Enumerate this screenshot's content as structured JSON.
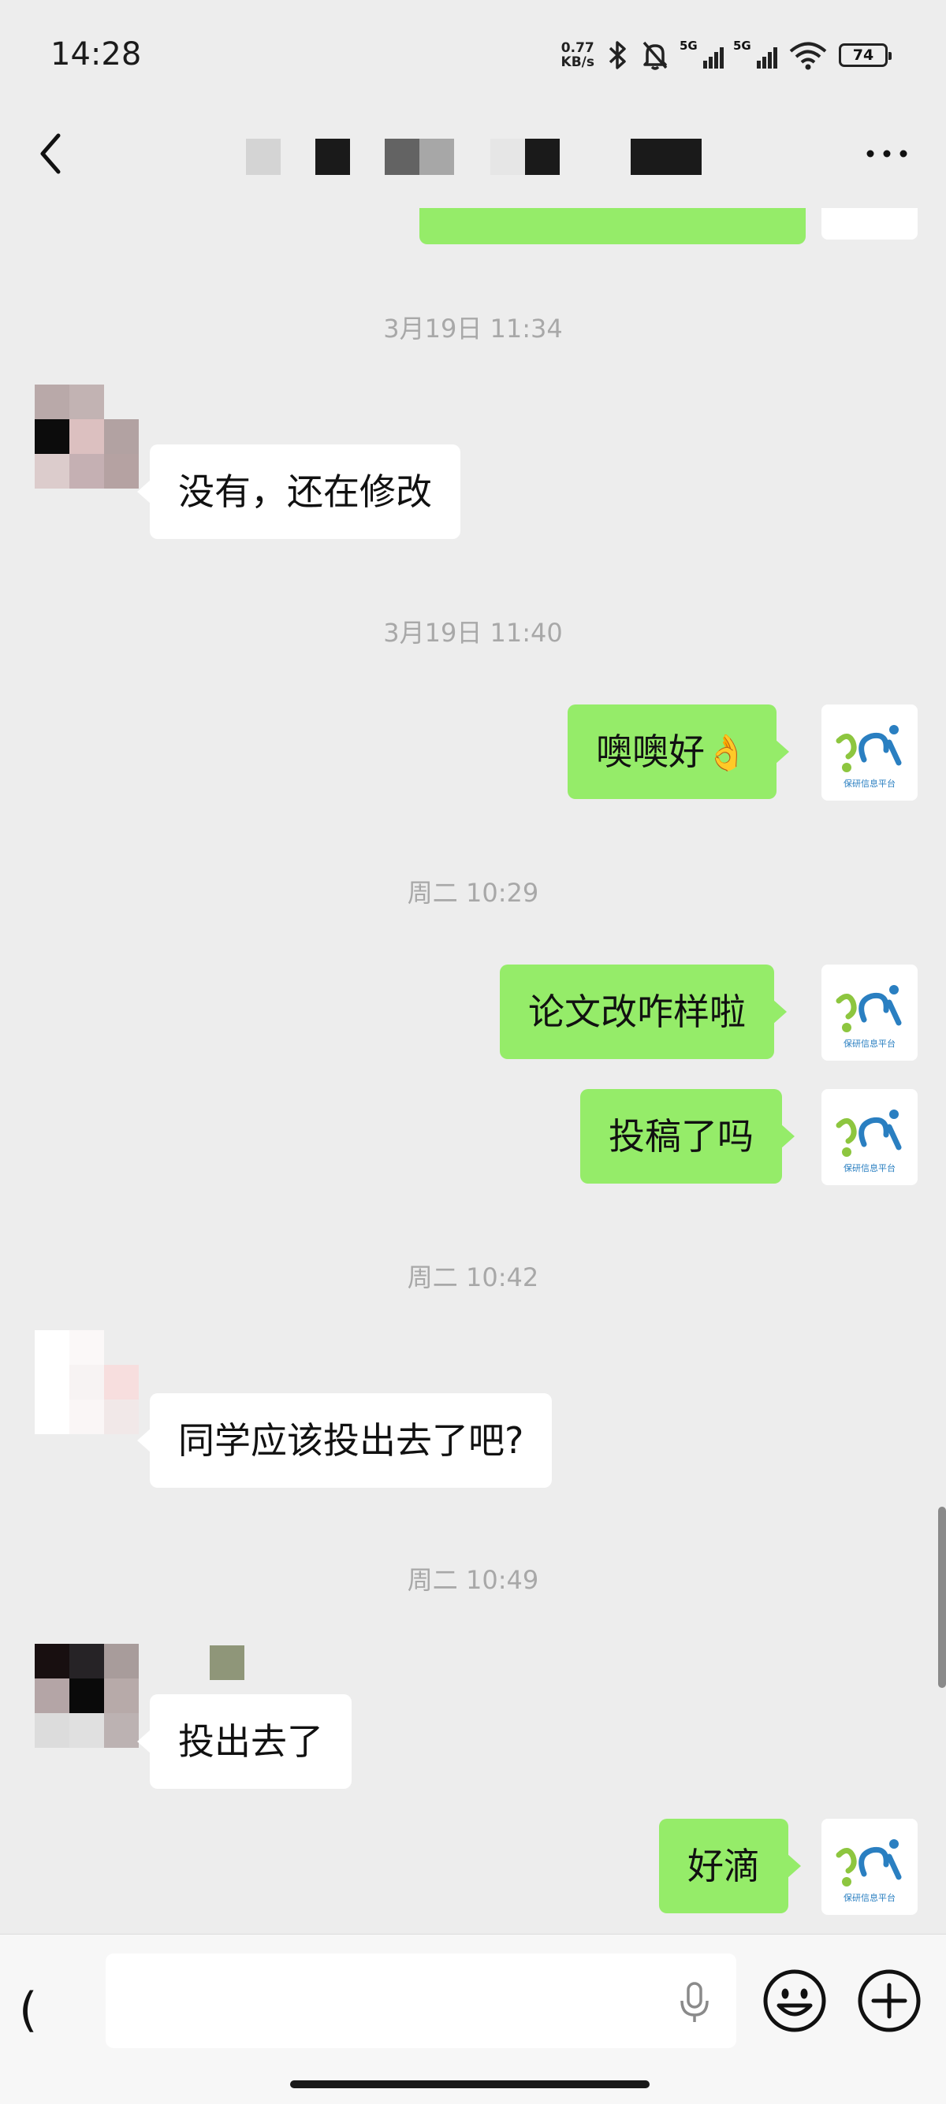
{
  "status_bar": {
    "time": "14:28",
    "net_speed_value": "0.77",
    "net_speed_unit": "KB/s",
    "sim1_label": "5G",
    "sim2_label": "5G",
    "battery_level": "74"
  },
  "header": {
    "back_icon": "chevron-left-icon",
    "more_icon": "more-dots-icon"
  },
  "messages": {
    "m1": {
      "timestamp": "3月19日 11:34",
      "text": "没有，还在修改"
    },
    "m2": {
      "timestamp": "3月19日 11:40",
      "text": "噢噢好",
      "emoji": "👌"
    },
    "m3": {
      "timestamp": "周二 10:29",
      "text": "论文改咋样啦"
    },
    "m4": {
      "text": "投稿了吗"
    },
    "m5": {
      "timestamp": "周二 10:42",
      "text": "同学应该投出去了吧?"
    },
    "m6": {
      "timestamp": "周二 10:49",
      "text": "投出去了"
    },
    "m7": {
      "text": "好滴"
    }
  },
  "my_avatar": {
    "caption": "保研信息平台",
    "colors": {
      "green": "#8dc63f",
      "blue": "#2a7fc1"
    }
  },
  "input_bar": {
    "voice_glyph": "(",
    "placeholder": ""
  },
  "colors": {
    "background": "#ededed",
    "bubble_out": "#95ec69",
    "bubble_in": "#ffffff"
  }
}
